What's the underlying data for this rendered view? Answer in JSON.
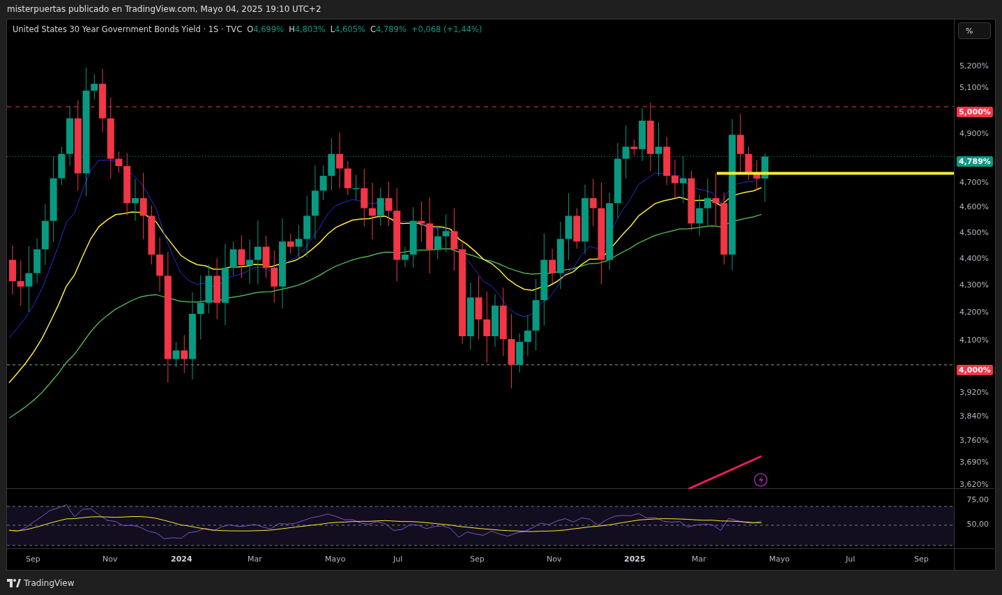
{
  "header": {
    "title": "misterpuertas publicado en TradingView.com, Mayo 04, 2025 19:10 UTC+2"
  },
  "legend": {
    "title": "United States 30 Year Government Bonds Yield · 1S · TVC",
    "values": [
      {
        "label": "O",
        "value": "4,699%"
      },
      {
        "label": "H",
        "value": "4,803%"
      },
      {
        "label": "L",
        "value": "4,605%"
      },
      {
        "label": "C",
        "value": "4,789%"
      }
    ],
    "change": "+0,068 (+1,44%)"
  },
  "scale_button": {
    "label": "%"
  },
  "price_axis": {
    "labels": [
      "5,200%",
      "5,100%",
      "4,900%",
      "4,700%",
      "4,600%",
      "4,500%",
      "4,400%",
      "4,300%",
      "4,200%",
      "4,100%",
      "3,920%",
      "3,840%",
      "3,760%",
      "3,690%",
      "3,620%"
    ],
    "badges": [
      {
        "label": "5,000%",
        "color": "#f23645"
      },
      {
        "label": "4,789%",
        "color": "#089981"
      },
      {
        "label": "4,000%",
        "color": "#f23645"
      }
    ]
  },
  "rsi_axis": {
    "labels": [
      "75,00",
      "50,00"
    ]
  },
  "time_axis": {
    "labels": [
      {
        "label": "Sep",
        "kind": "month"
      },
      {
        "label": "Nov",
        "kind": "month"
      },
      {
        "label": "2024",
        "kind": "year"
      },
      {
        "label": "Mar",
        "kind": "month"
      },
      {
        "label": "Mayo",
        "kind": "month"
      },
      {
        "label": "Jul",
        "kind": "month"
      },
      {
        "label": "Sep",
        "kind": "month"
      },
      {
        "label": "Nov",
        "kind": "month"
      },
      {
        "label": "2025",
        "kind": "year"
      },
      {
        "label": "Mar",
        "kind": "month"
      },
      {
        "label": "Mayo",
        "kind": "month"
      },
      {
        "label": "Jul",
        "kind": "month"
      },
      {
        "label": "Sep",
        "kind": "month"
      }
    ]
  },
  "footer": {
    "brand": "TradingView"
  }
}
